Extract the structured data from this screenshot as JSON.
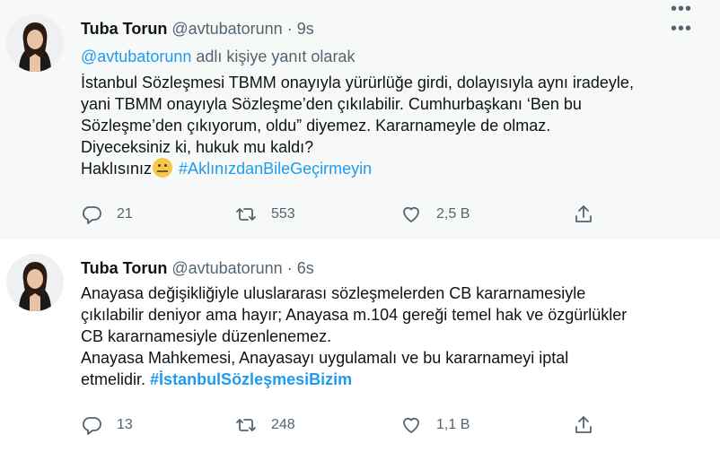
{
  "tweets": [
    {
      "name": "Tuba Torun",
      "handle": "@avtubatorunn",
      "dot": "·",
      "time": "9s",
      "more": "•••",
      "reply_to": {
        "mention": "@avtubatorunn",
        "suffix": " adlı kişiye yanıt olarak"
      },
      "lines": [
        "İstanbul Sözleşmesi TBMM onayıyla yürürlüğe girdi, dolayısıyla aynı iradeyle,",
        "yani TBMM onayıyla Sözleşme’den çıkılabilir. Cumhurbaşkanı ‘Ben bu",
        "Sözleşme’den çıkıyorum, oldu” diyemez. Kararnameyle de olmaz.",
        "Diyeceksiniz ki, hukuk mu kaldı?"
      ],
      "last_line_text": "Haklısınız",
      "hashtag": "#AklınızdanBileGeçirmeyin",
      "emoji": "zipper-mouth-face",
      "stats": {
        "replies": "21",
        "retweets": "553",
        "likes": "2,5 B"
      }
    },
    {
      "name": "Tuba Torun",
      "handle": "@avtubatorunn",
      "dot": "·",
      "time": "6s",
      "more": "•••",
      "lines": [
        "Anayasa değişikliğiyle uluslararası sözleşmelerden CB kararnamesiyle",
        "çıkılabilir deniyor ama hayır; Anayasa m.104 gereği temel hak ve özgürlükler",
        "CB kararnamesiyle düzenlenemez.",
        "Anayasa Mahkemesi, Anayasayı uygulamalı ve bu kararnameyi iptal"
      ],
      "last_line_text": "etmelidir.",
      "hashtag": "#İstanbulSözleşmesiBizim",
      "stats": {
        "replies": "13",
        "retweets": "248",
        "likes": "1,1 B"
      }
    }
  ],
  "icons": {
    "reply": "reply-icon",
    "retweet": "retweet-icon",
    "like": "heart-icon",
    "share": "share-icon",
    "more": "more-icon"
  },
  "colors": {
    "link": "#1d9bf0",
    "secondary": "#536471",
    "text": "#0f1419",
    "thread_bg": "#f7f9f9"
  }
}
